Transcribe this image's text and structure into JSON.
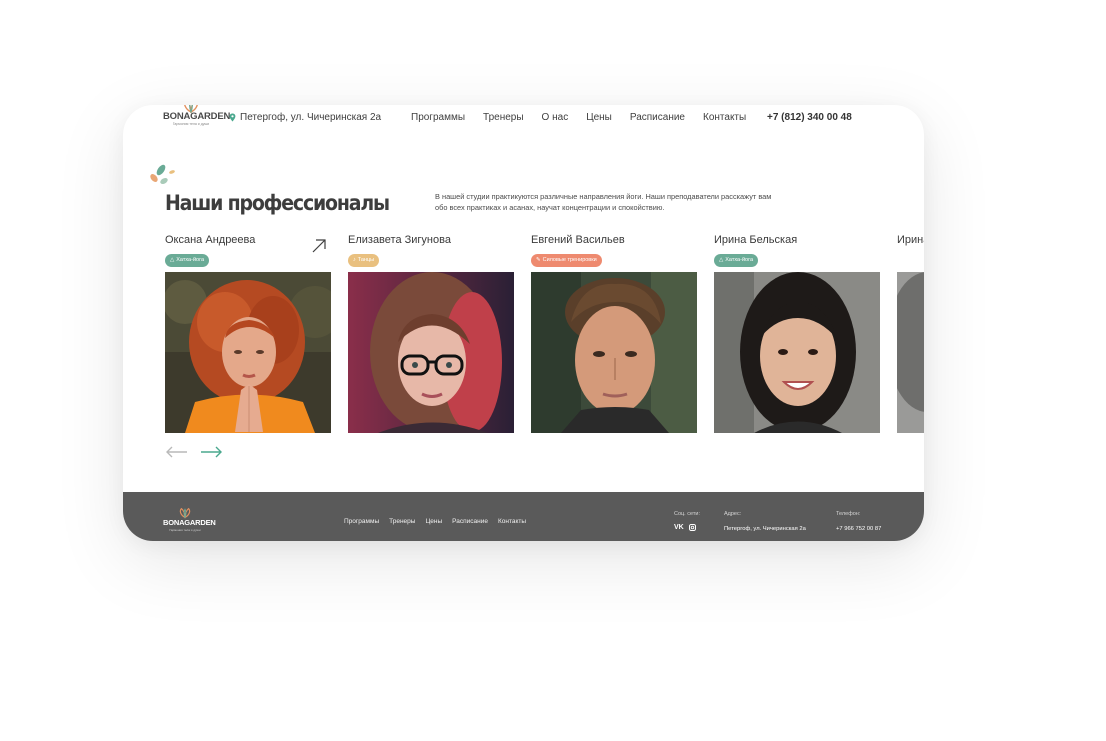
{
  "header": {
    "logo_name": "BONAGARDEN",
    "logo_tagline": "Гармония тела и души",
    "address": "Петергоф, ул. Чичеринская 2а",
    "nav": [
      "Программы",
      "Тренеры",
      "О нас",
      "Цены",
      "Расписание",
      "Контакты"
    ],
    "phone": "+7 (812) 340 00 48"
  },
  "section": {
    "title": "Наши профессионалы",
    "description": "В нашей студии практикуются различные направления йоги. Наши преподаватели расскажут вам обо всех практиках и асанах, научат концентрации и спокойствию."
  },
  "trainers": [
    {
      "name": "Оксана Андреева",
      "badge": "Хатха-йога",
      "badge_color": "#6aab96"
    },
    {
      "name": "Елизавета Зигунова",
      "badge": "Танцы",
      "badge_color": "#e9c07f"
    },
    {
      "name": "Евгений Васильев",
      "badge": "Силовые тренировки",
      "badge_color": "#ee8a6f"
    },
    {
      "name": "Ирина Бельская",
      "badge": "Хатха-йога",
      "badge_color": "#6aab96"
    },
    {
      "name": "Ирина"
    }
  ],
  "footer": {
    "logo_name": "BONAGARDEN",
    "logo_tagline": "Гармония тела и души",
    "nav": [
      "Программы",
      "Тренеры",
      "Цены",
      "Расписание",
      "Контакты"
    ],
    "social_label": "Соц. сети:",
    "address_label": "Адрес:",
    "address": "Петергоф, ул. Чичеринская 2а",
    "phone_label": "Телефон:",
    "phone": "+7 966 752 00 87"
  },
  "colors": {
    "accent_green": "#4aa88e",
    "footer_bg": "#5a5a5a"
  }
}
